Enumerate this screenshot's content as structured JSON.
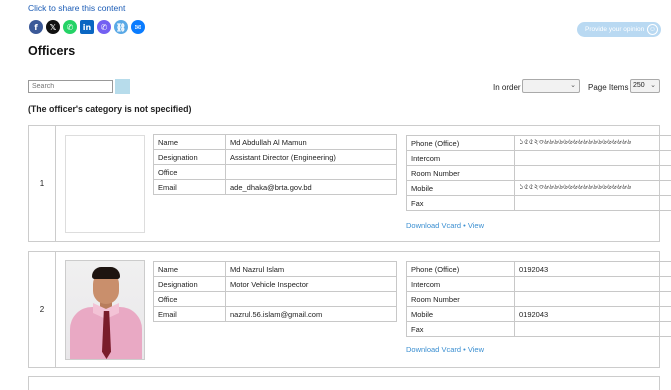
{
  "share": {
    "title": "Click to share this content",
    "icons": [
      "facebook-icon",
      "x-icon",
      "whatsapp-icon",
      "linkedin-icon",
      "viber-icon",
      "link-icon",
      "messenger-icon"
    ],
    "glyphs": [
      "f",
      "𝕏",
      "✆",
      "in",
      "✆",
      "⛓",
      "✉"
    ]
  },
  "feedback": {
    "label": "Provide your opinion",
    "icon": "☺"
  },
  "page": {
    "title": "Officers"
  },
  "controls": {
    "search_placeholder": "Search",
    "order_label": "In order",
    "order_value": "",
    "page_items_label": "Page Items",
    "page_items_value": "250"
  },
  "category_note": "(The officer's category is not specified)",
  "officers": [
    {
      "index": "1",
      "has_photo": false,
      "info": [
        {
          "key": "Name",
          "value": "Md Abdullah Al Mamun"
        },
        {
          "key": "Designation",
          "value": "Assistant Director (Engineering)"
        },
        {
          "key": "Office",
          "value": ""
        },
        {
          "key": "Email",
          "value": "ade_dhaka@brta.gov.bd"
        }
      ],
      "contacts": [
        {
          "key": "Phone (Office)",
          "value": "১৫৫২৩৬৬৬৬৬৬৬৬৬৬৬৬৬৬৬৬৬৬"
        },
        {
          "key": "Intercom",
          "value": ""
        },
        {
          "key": "Room Number",
          "value": ""
        },
        {
          "key": "Mobile",
          "value": "১৫৫২৩৬৬৬৬৬৬৬৬৬৬৬৬৬৬৬৬৬৬"
        },
        {
          "key": "Fax",
          "value": ""
        }
      ],
      "download_label": "Download Vcard",
      "sep": "•",
      "view_label": "View"
    },
    {
      "index": "2",
      "has_photo": true,
      "info": [
        {
          "key": "Name",
          "value": "Md Nazrul Islam"
        },
        {
          "key": "Designation",
          "value": "Motor Vehicle Inspector"
        },
        {
          "key": "Office",
          "value": ""
        },
        {
          "key": "Email",
          "value": "nazrul.56.islam@gmail.com"
        }
      ],
      "contacts": [
        {
          "key": "Phone (Office)",
          "value": "0192043"
        },
        {
          "key": "Intercom",
          "value": ""
        },
        {
          "key": "Room Number",
          "value": ""
        },
        {
          "key": "Mobile",
          "value": "0192043"
        },
        {
          "key": "Fax",
          "value": ""
        }
      ],
      "download_label": "Download Vcard",
      "sep": "•",
      "view_label": "View"
    }
  ]
}
